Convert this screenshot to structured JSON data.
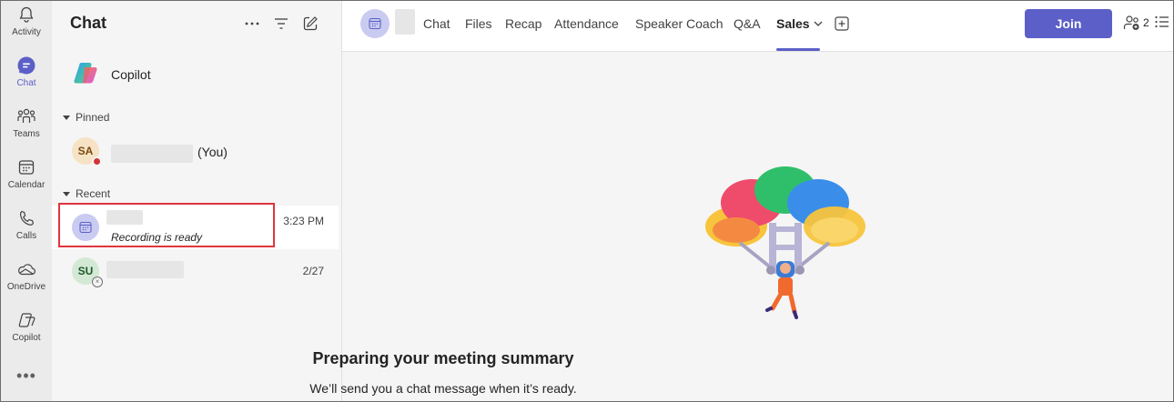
{
  "rail": {
    "items": [
      {
        "label": "Activity",
        "icon": "bell-icon"
      },
      {
        "label": "Chat",
        "icon": "chat-icon"
      },
      {
        "label": "Teams",
        "icon": "teams-icon"
      },
      {
        "label": "Calendar",
        "icon": "calendar-icon"
      },
      {
        "label": "Calls",
        "icon": "phone-icon"
      },
      {
        "label": "OneDrive",
        "icon": "cloud-icon"
      },
      {
        "label": "Copilot",
        "icon": "copilot-icon"
      }
    ],
    "more": "•••",
    "active_color": "#5b5fc7"
  },
  "chat_list": {
    "title": "Chat",
    "more_icon": "more-icon",
    "filter_icon": "filter-icon",
    "compose_icon": "compose-icon",
    "copilot_label": "Copilot",
    "pinned_label": "Pinned",
    "recent_label": "Recent",
    "pinned": [
      {
        "initials": "SA",
        "suffix": "(You)",
        "status": "busy"
      }
    ],
    "recent": [
      {
        "subtitle": "Recording is ready",
        "time": "3:23 PM"
      },
      {
        "initials": "SU",
        "time": "2/27"
      }
    ]
  },
  "meeting": {
    "tabs": [
      "Chat",
      "Files",
      "Recap",
      "Attendance",
      "Speaker Coach",
      "Q&A"
    ],
    "active_tab": "Sales",
    "join_label": "Join",
    "participant_count": "2",
    "accent": "#5b5fc7"
  },
  "summary": {
    "title": "Preparing your meeting summary",
    "subtitle": "We’ll send you a chat message when it’s ready."
  }
}
